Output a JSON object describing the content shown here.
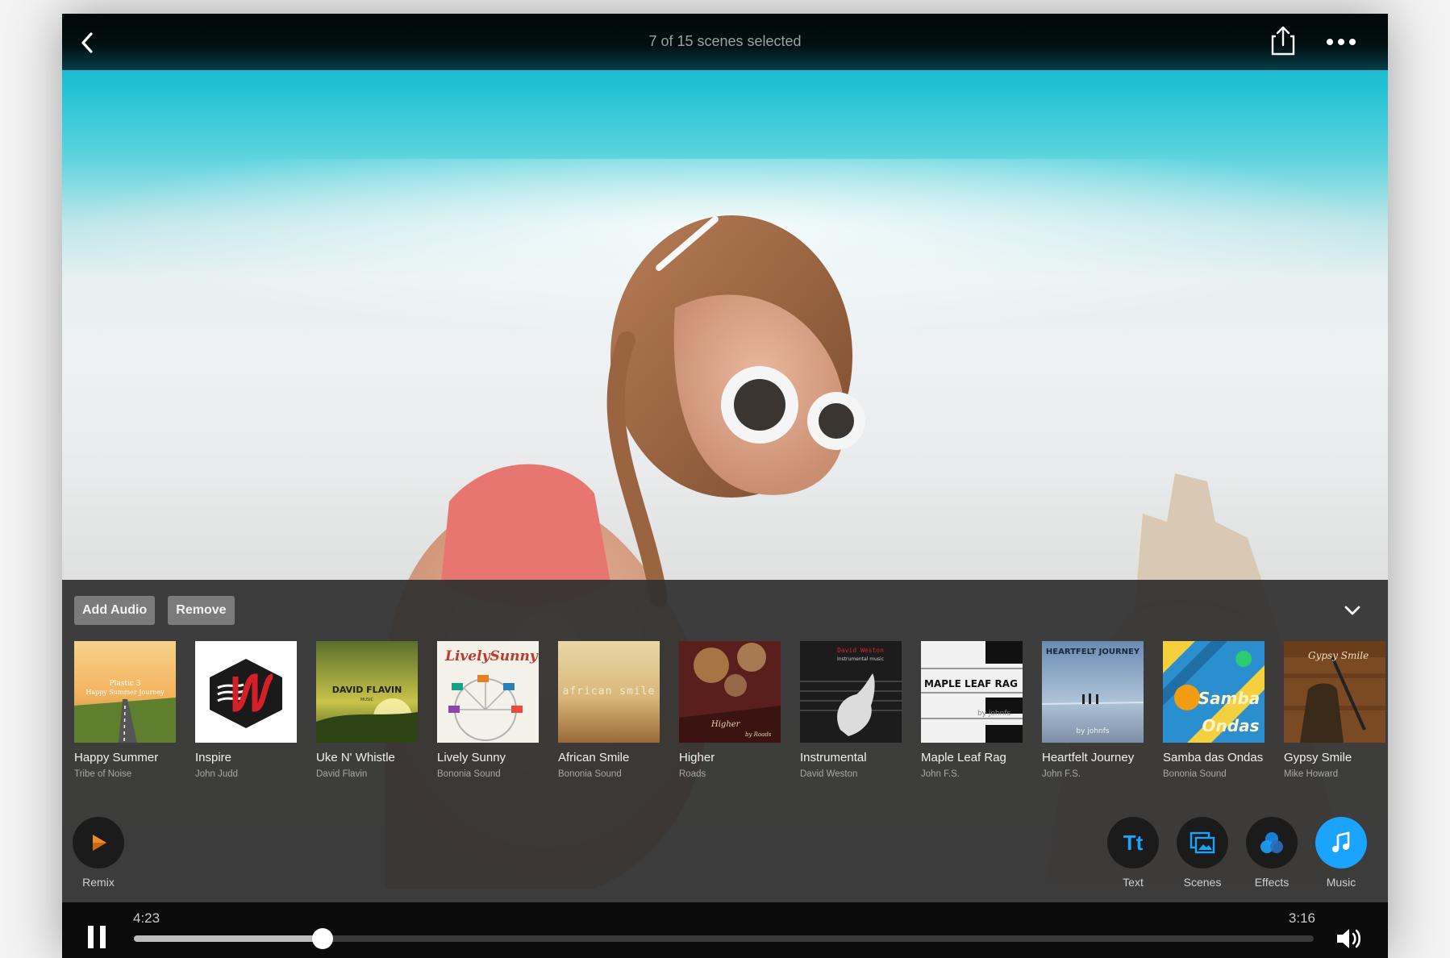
{
  "header": {
    "title": "7 of 15 scenes selected"
  },
  "panel": {
    "add_audio_label": "Add Audio",
    "remove_label": "Remove"
  },
  "tracks": [
    {
      "title": "Happy Summer",
      "artist": "Tribe of Noise",
      "art_text": "Plastic 3\nHappy Summer Journey"
    },
    {
      "title": "Inspire",
      "artist": "John Judd",
      "art_text": ""
    },
    {
      "title": "Uke N' Whistle",
      "artist": "David Flavin",
      "art_text": "DAVID FLAVIN"
    },
    {
      "title": "Lively Sunny",
      "artist": "Bononia Sound",
      "art_text": "LivelySunny"
    },
    {
      "title": "African Smile",
      "artist": "Bononia Sound",
      "art_text": "african smile"
    },
    {
      "title": "Higher",
      "artist": "Roads",
      "art_text": "Higher by Roads"
    },
    {
      "title": "Instrumental",
      "artist": "David Weston",
      "art_text": "David Weston\nInstrumental music"
    },
    {
      "title": "Maple Leaf Rag",
      "artist": "John F.S.",
      "art_text": "MAPLE LEAF RAG\nby johnfs"
    },
    {
      "title": "Heartfelt Journey",
      "artist": "John F.S.",
      "art_text": "HEARTFELT JOURNEY\nby johnfs"
    },
    {
      "title": "Samba das Ondas",
      "artist": "Bononia Sound",
      "art_text": "Samba das Ondas"
    },
    {
      "title": "Gypsy Smile",
      "artist": "Mike Howard",
      "art_text": "Gypsy Smile"
    }
  ],
  "tools": {
    "remix": "Remix",
    "text": "Text",
    "scenes": "Scenes",
    "effects": "Effects",
    "music": "Music"
  },
  "player": {
    "elapsed": "4:23",
    "remaining": "3:16",
    "progress": 0.16
  },
  "colors": {
    "accent": "#1aa3ff",
    "remix_orange": "#f08a24"
  }
}
